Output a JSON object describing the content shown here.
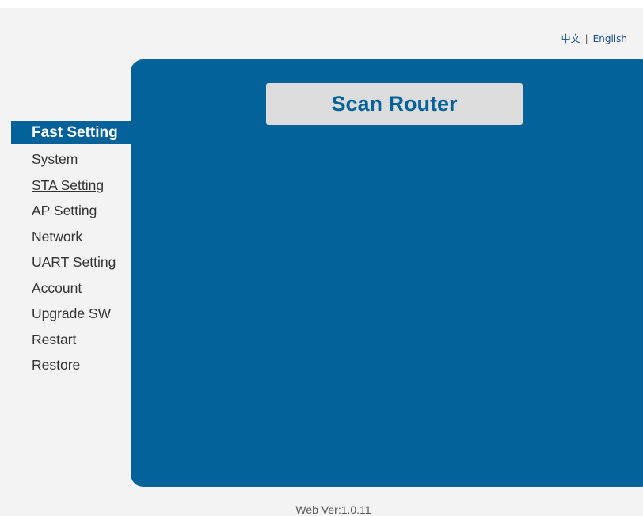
{
  "header": {
    "lang_chinese": "中文",
    "lang_separator": "|",
    "lang_english": "English"
  },
  "main": {
    "scan_router_label": "Scan Router"
  },
  "sidebar": {
    "items": [
      {
        "label": "Fast Setting"
      },
      {
        "label": "System"
      },
      {
        "label": "STA Setting"
      },
      {
        "label": "AP Setting"
      },
      {
        "label": "Network"
      },
      {
        "label": "UART Setting"
      },
      {
        "label": "Account"
      },
      {
        "label": "Upgrade SW"
      },
      {
        "label": "Restart"
      },
      {
        "label": "Restore"
      }
    ]
  },
  "footer": {
    "version": "Web Ver:1.0.11"
  },
  "colors": {
    "accent": "#03629a",
    "button_bg": "#dcdcdc",
    "page_bg": "#f3f3f3"
  }
}
